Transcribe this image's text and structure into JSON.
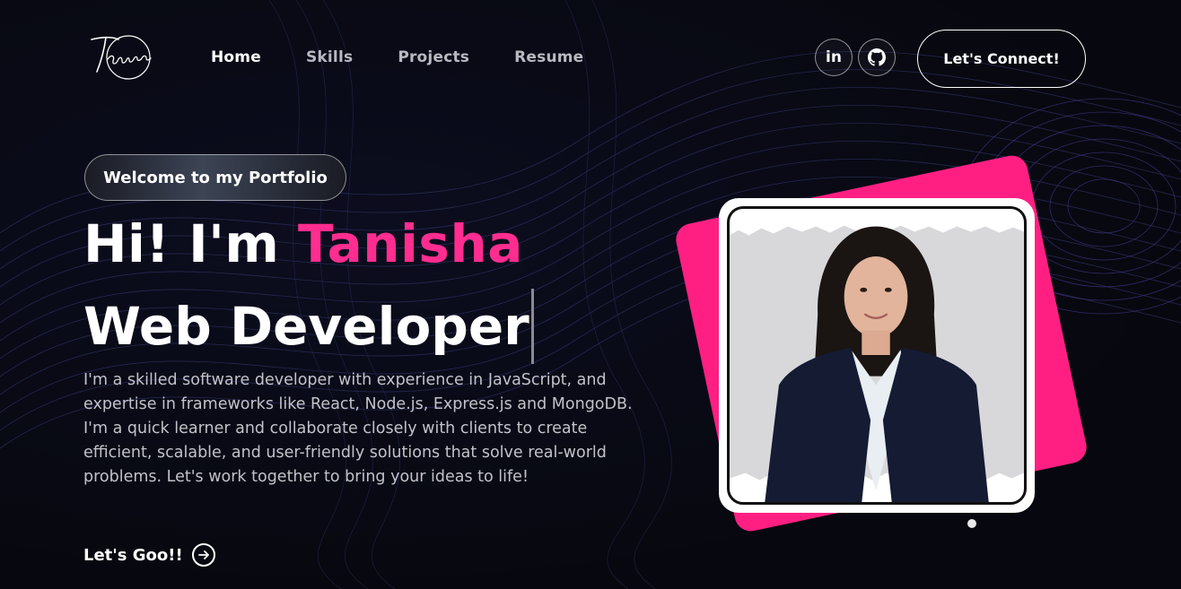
{
  "brand": {
    "logo_text": "Tanisha"
  },
  "nav": {
    "links": [
      {
        "label": "Home",
        "active": true
      },
      {
        "label": "Skills",
        "active": false
      },
      {
        "label": "Projects",
        "active": false
      },
      {
        "label": "Resume",
        "active": false
      }
    ],
    "social": [
      {
        "icon": "linkedin-icon",
        "glyph": "in"
      },
      {
        "icon": "github-icon"
      }
    ],
    "connect_label": "Let's Connect!"
  },
  "hero": {
    "welcome": "Welcome to my Portfolio",
    "greeting": "Hi! I'm ",
    "name": "Tanisha",
    "role": "Web Developer",
    "description": "I'm a skilled software developer with experience in JavaScript, and expertise in frameworks like React, Node.js, Express.js and MongoDB. I'm a quick learner and collaborate closely with clients to create efficient, scalable, and user-friendly solutions that solve real-world problems. Let's work together to bring your ideas to life!",
    "cta_label": "Let's Goo!!"
  },
  "colors": {
    "background": "#070812",
    "accent_pink": "#ff2d8f",
    "card_pink": "#ff1f82",
    "text": "#ffffff",
    "muted_text": "#c2c2ca"
  }
}
